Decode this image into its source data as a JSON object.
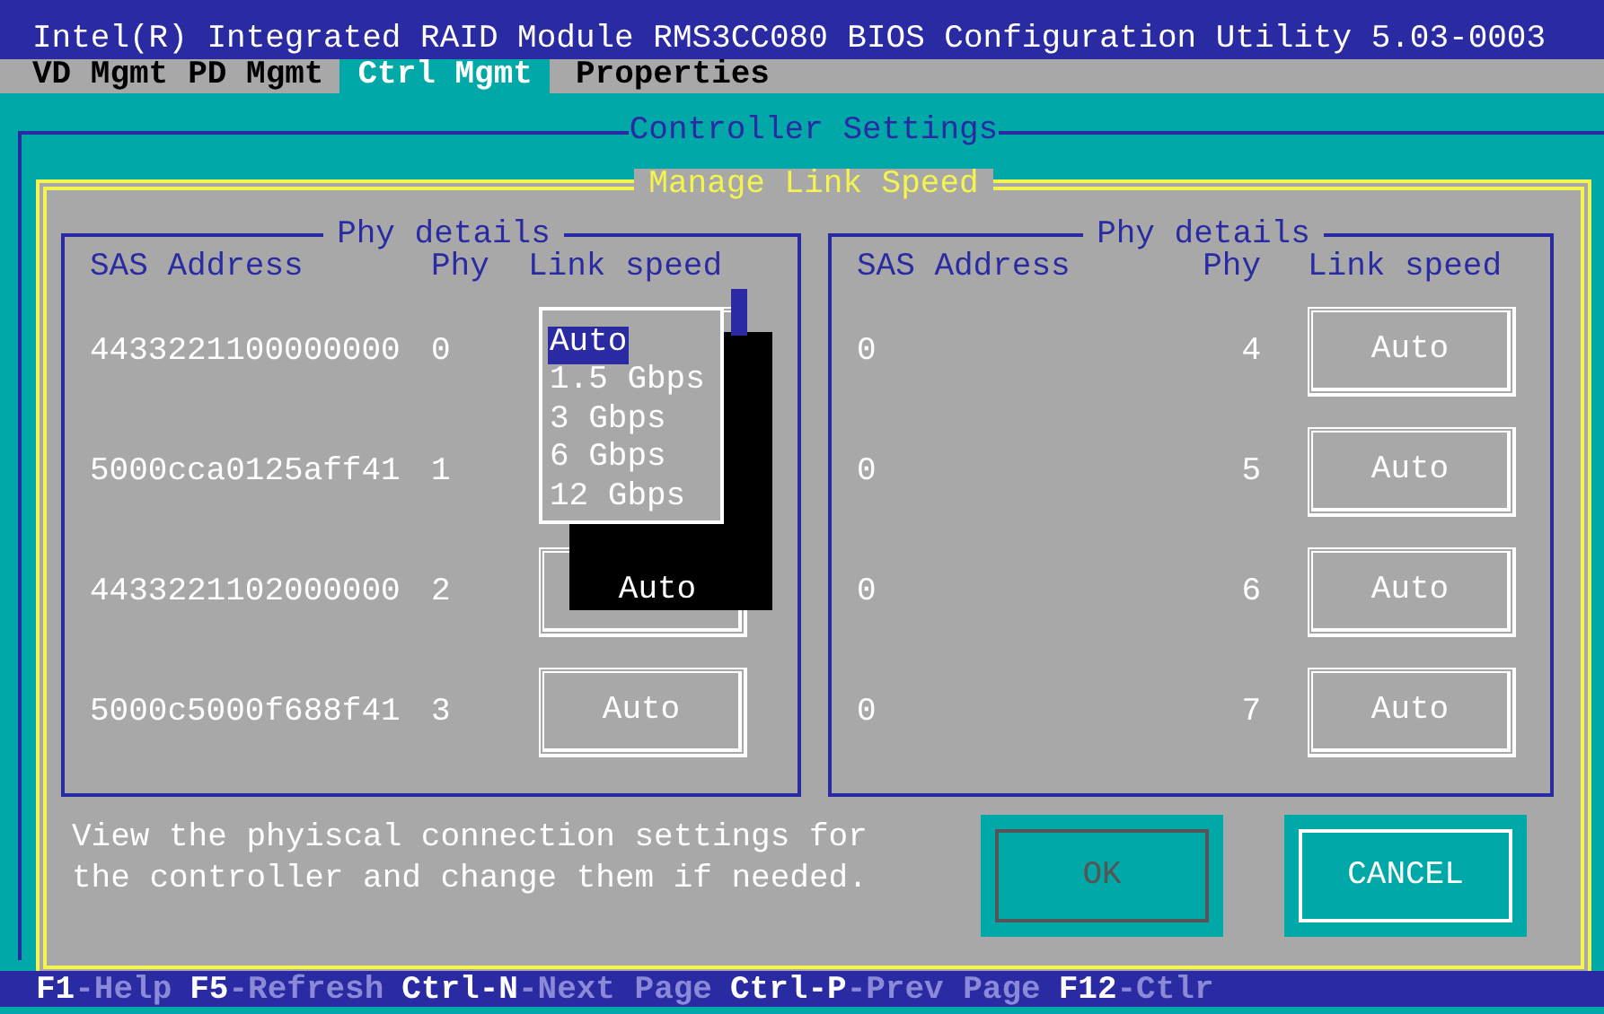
{
  "title_bar": {
    "title": "Intel(R) Integrated RAID Module RMS3CC080 BIOS Configuration Utility 5.03-0003"
  },
  "menu": [
    {
      "label": "VD Mgmt",
      "selected": false
    },
    {
      "label": "PD Mgmt",
      "selected": false
    },
    {
      "label": "Ctrl Mgmt",
      "selected": true
    },
    {
      "label": "Properties",
      "selected": false
    }
  ],
  "section_title": "Controller Settings",
  "dialog": {
    "title": "Manage Link Speed",
    "panels": [
      {
        "title": "Phy details",
        "columns": [
          "SAS Address",
          "Phy",
          "Link speed"
        ],
        "rows": [
          {
            "sas_address": "4433221100000000",
            "phy": "0",
            "dropdown": {
              "options": [
                {
                  "label": "Auto",
                  "selected": true
                },
                {
                  "label": "1.5 Gbps",
                  "selected": false
                },
                {
                  "label": "3 Gbps",
                  "selected": false
                },
                {
                  "label": "6 Gbps",
                  "selected": false
                },
                {
                  "label": "12 Gbps",
                  "selected": false
                }
              ]
            }
          },
          {
            "sas_address": "5000cca0125aff41",
            "phy": "1"
          },
          {
            "sas_address": "4433221102000000",
            "phy": "2",
            "link_speed": "Auto",
            "highlighted": true
          },
          {
            "sas_address": "5000c5000f688f41",
            "phy": "3",
            "link_speed": "Auto",
            "highlighted": false
          }
        ]
      },
      {
        "title": "Phy details",
        "columns": [
          "SAS Address",
          "Phy",
          "Link speed"
        ],
        "rows": [
          {
            "sas_address": "0",
            "phy": "4",
            "link_speed": "Auto",
            "highlighted": false
          },
          {
            "sas_address": "0",
            "phy": "5",
            "link_speed": "Auto",
            "highlighted": false
          },
          {
            "sas_address": "0",
            "phy": "6",
            "link_speed": "Auto",
            "highlighted": false
          },
          {
            "sas_address": "0",
            "phy": "7",
            "link_speed": "Auto",
            "highlighted": false
          }
        ]
      }
    ],
    "description": "View the phyiscal connection settings for the controller and change them if needed.",
    "buttons": [
      {
        "label": "OK",
        "disabled": true
      },
      {
        "label": "CANCEL",
        "disabled": false
      }
    ]
  },
  "status_bar": [
    {
      "key": "F1",
      "action": "-Help"
    },
    {
      "key": "F5",
      "action": "-Refresh"
    },
    {
      "key": "Ctrl-N",
      "action": "-Next Page"
    },
    {
      "key": "Ctrl-P",
      "action": "-Prev Page"
    },
    {
      "key": "F12",
      "action": "-Ctlr"
    }
  ]
}
